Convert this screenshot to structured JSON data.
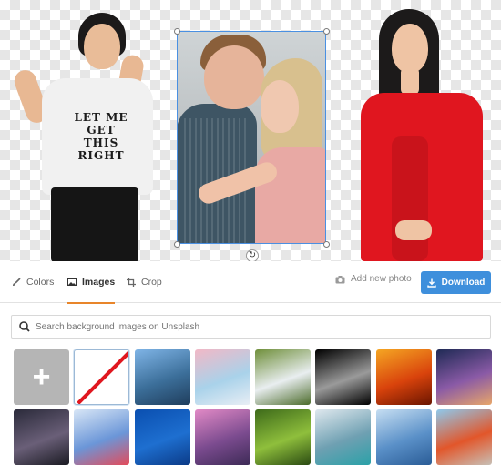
{
  "canvas": {
    "tshirt_text": [
      "LET ME",
      "GET",
      "THIS",
      "RIGHT"
    ]
  },
  "toolbar": {
    "tabs": [
      {
        "label": "Colors",
        "icon": "brush-icon",
        "active": false
      },
      {
        "label": "Images",
        "icon": "image-icon",
        "active": true
      },
      {
        "label": "Crop",
        "icon": "crop-icon",
        "active": false
      }
    ],
    "add_photo_label": "Add new photo",
    "download_label": "Download"
  },
  "search": {
    "placeholder": "Search background images on Unsplash",
    "value": ""
  },
  "thumbnails": [
    {
      "name": "add-image",
      "kind": "add",
      "label": "+"
    },
    {
      "name": "no-background",
      "kind": "none"
    },
    {
      "name": "city-skyline",
      "colors": [
        "#7fb4e6",
        "#3c6f9a",
        "#1f3d5c"
      ]
    },
    {
      "name": "pastel-abstract",
      "colors": [
        "#f2b8c6",
        "#a9d2ea",
        "#e9eef5"
      ]
    },
    {
      "name": "waterfall",
      "colors": [
        "#6f8f3a",
        "#e9eef0",
        "#4b6b2a"
      ]
    },
    {
      "name": "full-moon",
      "colors": [
        "#000000",
        "#9a9a9a",
        "#000000"
      ]
    },
    {
      "name": "fire",
      "colors": [
        "#f5a623",
        "#d9430c",
        "#6b1500"
      ]
    },
    {
      "name": "milky-way-dusk",
      "colors": [
        "#1f2a55",
        "#8a5aa6",
        "#e8a66a"
      ]
    },
    {
      "name": "night-sky",
      "colors": [
        "#2a2a3a",
        "#6a5f78",
        "#1a1a22"
      ]
    },
    {
      "name": "confetti",
      "colors": [
        "#d8e6f6",
        "#6b96d8",
        "#e44b5a"
      ]
    },
    {
      "name": "underwater",
      "colors": [
        "#0a4fb0",
        "#1e6fd0",
        "#0b3a86"
      ]
    },
    {
      "name": "canal-city",
      "colors": [
        "#e28ac6",
        "#7b4b8f",
        "#3c2a55"
      ]
    },
    {
      "name": "forest-path",
      "colors": [
        "#3d6a1a",
        "#8fbf3c",
        "#2a4a12"
      ]
    },
    {
      "name": "mountain-lake",
      "colors": [
        "#dfe8ee",
        "#6fa0b2",
        "#2aa1a8"
      ]
    },
    {
      "name": "blue-mountains",
      "colors": [
        "#c6def2",
        "#5a90c8",
        "#2a5c96"
      ]
    },
    {
      "name": "desert-trees",
      "colors": [
        "#8ec9ec",
        "#e2562a",
        "#c8c0b6"
      ]
    }
  ]
}
